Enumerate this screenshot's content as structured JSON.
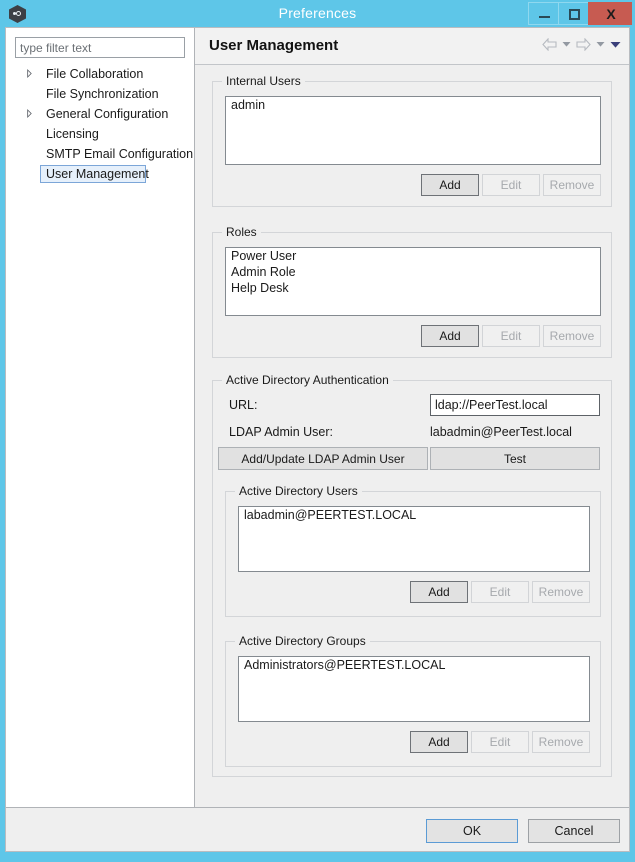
{
  "window": {
    "title": "Preferences",
    "icon": "app-hexagon-icon",
    "controls": {
      "minimize": "minimize-icon",
      "maximize": "maximize-icon",
      "close": "X"
    },
    "titlebar_color": "#5ec6e8",
    "close_button_color": "#c75b51"
  },
  "sidebar": {
    "filter": {
      "placeholder": "type filter text",
      "value": ""
    },
    "items": [
      {
        "label": "File Collaboration",
        "expandable": true,
        "selected": false
      },
      {
        "label": "File Synchronization",
        "expandable": false,
        "selected": false
      },
      {
        "label": "General Configuration",
        "expandable": true,
        "selected": false
      },
      {
        "label": "Licensing",
        "expandable": false,
        "selected": false
      },
      {
        "label": "SMTP Email Configuration",
        "expandable": false,
        "selected": false
      },
      {
        "label": "User Management",
        "expandable": false,
        "selected": true
      }
    ]
  },
  "content": {
    "title": "User Management",
    "nav": {
      "back": "back-arrow-icon",
      "back_menu": "chevron-down-icon",
      "forward": "forward-arrow-icon",
      "forward_menu": "chevron-down-icon",
      "view_menu": "chevron-down-icon"
    },
    "internal_users": {
      "title": "Internal Users",
      "items": [
        "admin"
      ],
      "buttons": {
        "add": {
          "label": "Add",
          "enabled": true
        },
        "edit": {
          "label": "Edit",
          "enabled": false
        },
        "remove": {
          "label": "Remove",
          "enabled": false
        }
      }
    },
    "roles": {
      "title": "Roles",
      "items": [
        "Power User",
        "Admin Role",
        "Help Desk"
      ],
      "buttons": {
        "add": {
          "label": "Add",
          "enabled": true
        },
        "edit": {
          "label": "Edit",
          "enabled": false
        },
        "remove": {
          "label": "Remove",
          "enabled": false
        }
      }
    },
    "active_directory": {
      "title": "Active Directory Authentication",
      "url_label": "URL:",
      "url_value": "ldap://PeerTest.local",
      "ldap_admin_label": "LDAP Admin User:",
      "ldap_admin_value": "labadmin@PeerTest.local",
      "add_update_button": "Add/Update LDAP Admin User",
      "test_button": "Test",
      "users": {
        "title": "Active Directory Users",
        "items": [
          "labadmin@PEERTEST.LOCAL"
        ],
        "buttons": {
          "add": {
            "label": "Add",
            "enabled": true
          },
          "edit": {
            "label": "Edit",
            "enabled": false
          },
          "remove": {
            "label": "Remove",
            "enabled": false
          }
        }
      },
      "groups": {
        "title": "Active Directory Groups",
        "items": [
          "Administrators@PEERTEST.LOCAL"
        ],
        "buttons": {
          "add": {
            "label": "Add",
            "enabled": true
          },
          "edit": {
            "label": "Edit",
            "enabled": false
          },
          "remove": {
            "label": "Remove",
            "enabled": false
          }
        }
      }
    }
  },
  "footer": {
    "ok_label": "OK",
    "cancel_label": "Cancel"
  }
}
